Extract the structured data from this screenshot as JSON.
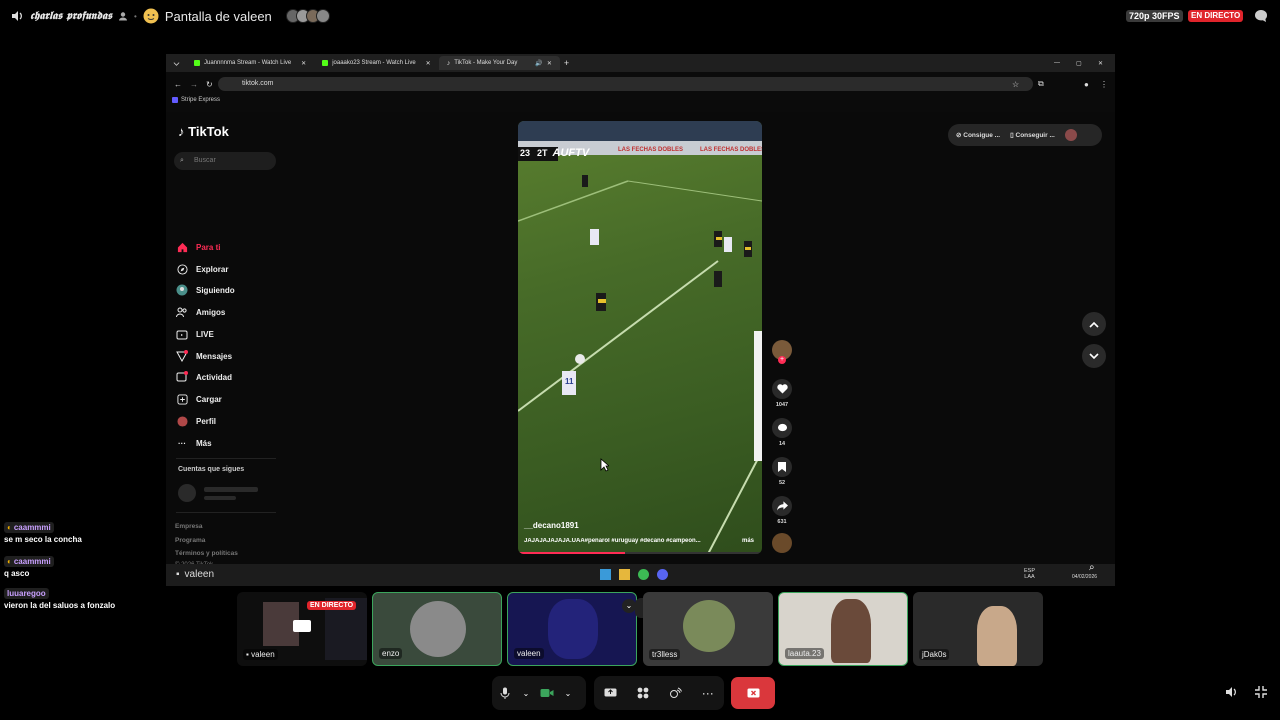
{
  "topbar": {
    "channel_name": "𝖈𝖍𝖆𝖗𝖑𝖆𝖘 𝖕𝖗𝖔𝖋𝖚𝖓𝖉𝖆𝖘",
    "screen_title": "Pantalla de valeen",
    "quality": "720p 30FPS",
    "live_badge": "EN DIRECTO"
  },
  "browser": {
    "tabs": [
      "Juannnnma Stream - Watch Live",
      "joaaako23 Stream - Watch Live",
      "TikTok - Make Your Day"
    ],
    "url": "tiktok.com",
    "bookmark": "Stripe Express"
  },
  "tiktok": {
    "logo": "TikTok",
    "search_placeholder": "Buscar",
    "nav": [
      {
        "label": "Para ti",
        "icon": "home-icon",
        "active": true
      },
      {
        "label": "Explorar",
        "icon": "compass-icon"
      },
      {
        "label": "Siguiendo",
        "icon": "following-avatar-icon"
      },
      {
        "label": "Amigos",
        "icon": "friends-icon"
      },
      {
        "label": "LIVE",
        "icon": "live-tv-icon"
      },
      {
        "label": "Mensajes",
        "icon": "messages-icon"
      },
      {
        "label": "Actividad",
        "icon": "activity-icon"
      },
      {
        "label": "Cargar",
        "icon": "upload-plus-icon"
      },
      {
        "label": "Perfil",
        "icon": "profile-avatar-icon"
      },
      {
        "label": "Más",
        "icon": "more-dots-icon"
      }
    ],
    "following_title": "Cuentas que sigues",
    "footer": [
      "Empresa",
      "Programa",
      "Términos y políticas",
      "© 2026 TikTok"
    ],
    "pills": [
      "Consigue ...",
      "Conseguir ..."
    ],
    "video": {
      "author": "__decano1891",
      "caption": "JAJAJAJAJAJA.UAA#peñarol #uruguay #decano #campeon...",
      "more": "más",
      "overlay_period": "2T",
      "overlay_num": "23",
      "overlay_brand": "AUFTV",
      "player_number": "11"
    },
    "actions": {
      "likes": "1047",
      "comments": "14",
      "saves": "52",
      "shares": "631"
    }
  },
  "taskbar": {
    "label": "valeen",
    "lang_top": "ESP",
    "lang_bottom": "LAA",
    "date": "04/02/2026"
  },
  "chat": [
    {
      "user": "caammmi",
      "text": "se m seco la concha"
    },
    {
      "user": "caammmi",
      "text": "q asco"
    },
    {
      "user": "luuaregoo",
      "text": "vieron la del saluos a fonzalo"
    }
  ],
  "participants": [
    {
      "name": "valeen",
      "live": "EN DIRECTO"
    },
    {
      "name": "enzo"
    },
    {
      "name": "valeen"
    },
    {
      "name": "tr3lless"
    },
    {
      "name": "laauta.23"
    },
    {
      "name": "jDak0s"
    }
  ],
  "colors": {
    "live_red": "#e0242b",
    "speaking_green": "#3ba55c",
    "leave_red": "#da373c",
    "tiktok_pink": "#fe2c55"
  }
}
